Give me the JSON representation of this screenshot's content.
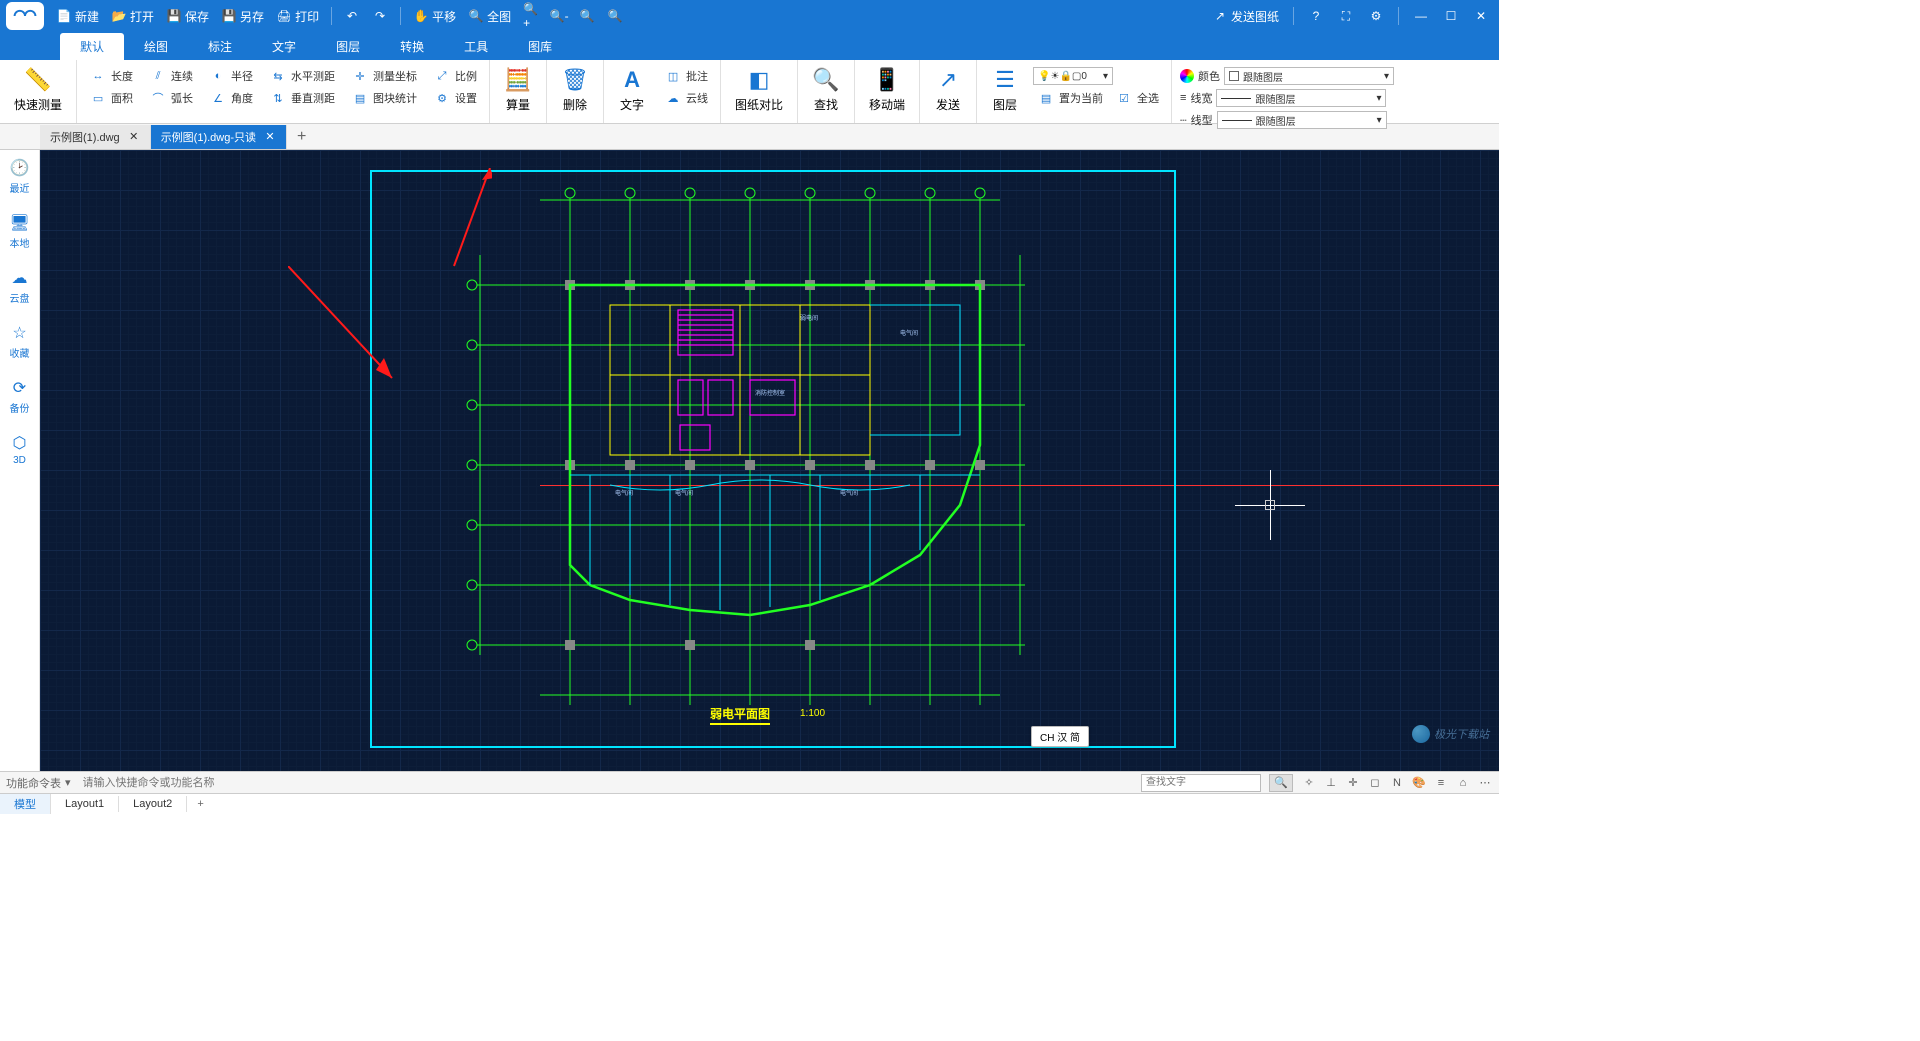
{
  "titlebar": {
    "qat": {
      "new": "新建",
      "open": "打开",
      "save": "保存",
      "saveas": "另存",
      "print": "打印",
      "pan": "平移",
      "fit": "全图"
    },
    "send": "发送图纸"
  },
  "ribbon": {
    "tabs": [
      "默认",
      "绘图",
      "标注",
      "文字",
      "图层",
      "转换",
      "工具",
      "图库"
    ],
    "quick_measure": "快速测量",
    "measure": {
      "length": "长度",
      "continuous": "连续",
      "radius": "半径",
      "hdist": "水平测距",
      "area": "面积",
      "arc": "弧长",
      "angle": "角度",
      "vdist": "垂直测距",
      "coord": "测量坐标",
      "scale": "比例",
      "block_stats": "图块统计",
      "settings": "设置"
    },
    "calc": "算量",
    "delete": "删除",
    "text": "文字",
    "cloud": "云线",
    "annotate": "批注",
    "compare": "图纸对比",
    "find": "查找",
    "mobile": "移动端",
    "send": "发送",
    "layer": "图层",
    "set_current": "置为当前",
    "select_all": "全选",
    "props": {
      "color_label": "颜色",
      "color_value": "跟随图层",
      "lw_label": "线宽",
      "lw_value": "跟随图层",
      "lt_label": "线型",
      "lt_value": "跟随图层"
    },
    "layer_combo": "0"
  },
  "file_tabs": [
    {
      "label": "示例图(1).dwg",
      "active": false
    },
    {
      "label": "示例图(1).dwg-只读",
      "active": true
    }
  ],
  "sidebar": [
    {
      "label": "最近",
      "icon": "clock"
    },
    {
      "label": "本地",
      "icon": "monitor"
    },
    {
      "label": "云盘",
      "icon": "cloud"
    },
    {
      "label": "收藏",
      "icon": "star"
    },
    {
      "label": "备份",
      "icon": "backup"
    },
    {
      "label": "3D",
      "icon": "cube"
    }
  ],
  "drawing": {
    "title": "弱电平面图",
    "scale": "1:100"
  },
  "cmdbar": {
    "label": "功能命令表",
    "placeholder": "请输入快捷命令或功能名称",
    "search_placeholder": "查找文字",
    "ime": "CH 汉 简"
  },
  "layout_tabs": [
    "模型",
    "Layout1",
    "Layout2"
  ],
  "watermark": "极光下载站"
}
